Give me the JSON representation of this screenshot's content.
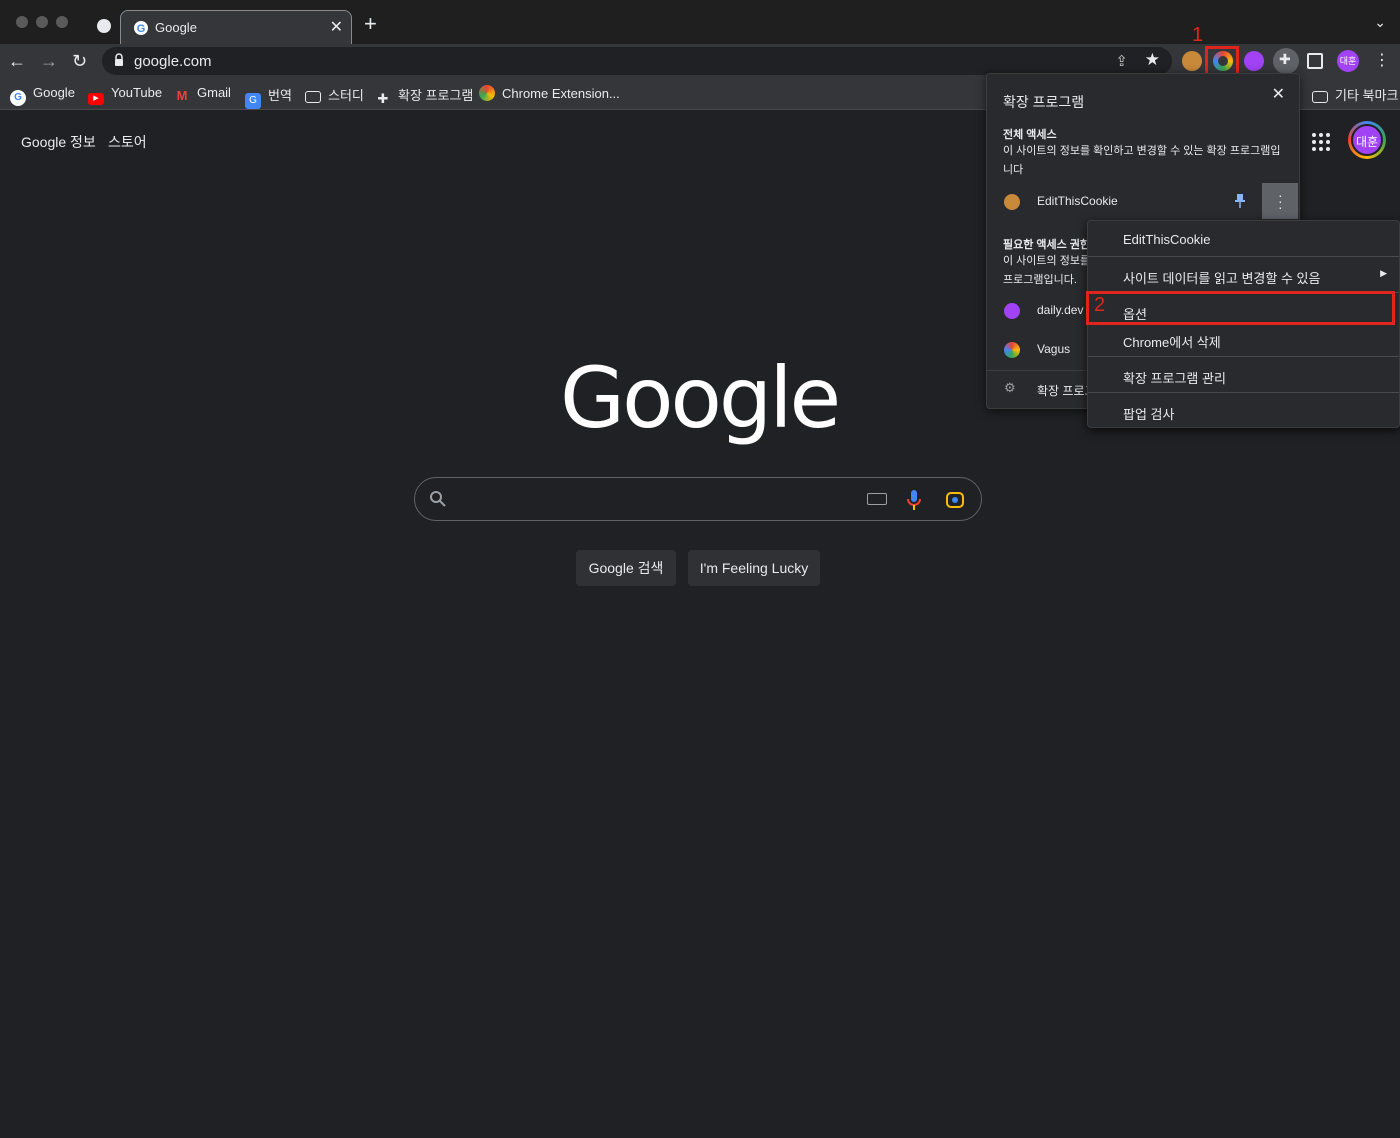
{
  "tab": {
    "title": "Google",
    "close": "✕",
    "new": "+"
  },
  "toolbar": {
    "url": "google.com",
    "profile_initials": "대훈"
  },
  "annotations": {
    "one": "1",
    "two": "2"
  },
  "bookmarks": [
    {
      "label": "Google"
    },
    {
      "label": "YouTube"
    },
    {
      "label": "Gmail"
    },
    {
      "label": "번역"
    },
    {
      "label": "스터디"
    },
    {
      "label": "확장 프로그램"
    },
    {
      "label": "Chrome Extension..."
    }
  ],
  "other_bookmarks": "기타 북마크",
  "page": {
    "links": [
      "Google 정보",
      "스토어"
    ],
    "logo": "Google",
    "avatar": "대훈",
    "buttons": [
      "Google 검색",
      "I'm Feeling Lucky"
    ]
  },
  "popup": {
    "title": "확장 프로그램",
    "close": "✕",
    "full_access": {
      "heading": "전체 액세스",
      "desc": "이 사이트의 정보를 확인하고 변경할 수 있는 확장 프로그램입니다",
      "items": [
        "EditThisCookie"
      ]
    },
    "required_access": {
      "heading": "필요한 액세스 권한",
      "desc": "이 사이트의 정보를 확인하고 변경하려면 권한이 필요한 확장 프로그램입니다.",
      "items": [
        "daily.dev",
        "Vagus"
      ]
    },
    "manage": "확장 프로그램 관리"
  },
  "context_menu": {
    "items": [
      "EditThisCookie",
      "사이트 데이터를 읽고 변경할 수 있음",
      "옵션",
      "Chrome에서 삭제",
      "확장 프로그램 관리",
      "팝업 검사"
    ]
  }
}
